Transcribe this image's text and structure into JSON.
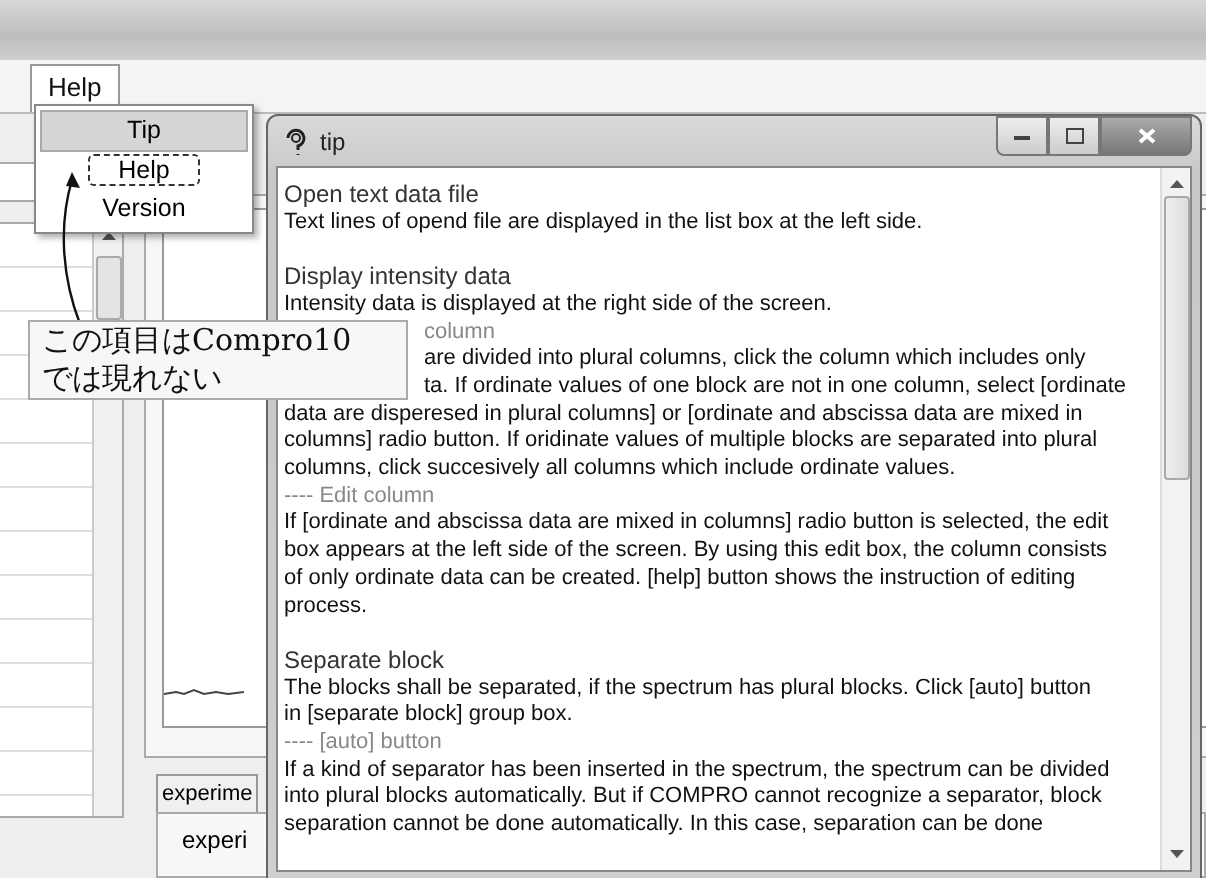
{
  "menu_bar": [
    {
      "label": "Help",
      "selected": true
    }
  ],
  "help_menu": [
    {
      "label": "Tip",
      "selected": true,
      "focused": false
    },
    {
      "label": "Help",
      "selected": false,
      "focused": true
    },
    {
      "label": "Version",
      "selected": false,
      "focused": false
    }
  ],
  "background_window": {
    "tab": "experime",
    "group_label": "experi"
  },
  "tip_window": {
    "title": "tip",
    "sections": [
      {
        "items": [
          {
            "kind": "heading",
            "text": "Open text data file"
          },
          {
            "kind": "text",
            "text": "Text lines of opend file are displayed in the list box at the left side."
          }
        ]
      },
      {
        "items": [
          {
            "kind": "heading",
            "text": "Display intensity data"
          },
          {
            "kind": "text",
            "text": "Intensity data is displayed at the right side of the screen."
          },
          {
            "kind": "sub-clipped",
            "text": "column"
          },
          {
            "kind": "clipped",
            "text": "are divided into plural columns, click the column which includes only"
          },
          {
            "kind": "clipped",
            "text": "ta.  If ordinate values of one block are not in one column, select [ordinate"
          },
          {
            "kind": "text",
            "text": "data are disperesed in plural columns] or [ordinate and abscissa data are mixed in"
          },
          {
            "kind": "text",
            "text": "columns] radio button.  If oridinate values of multiple blocks are separated into plural"
          },
          {
            "kind": "text",
            "text": "columns, click succesively all columns which include ordinate values."
          },
          {
            "kind": "sub",
            "text": "---- Edit column"
          },
          {
            "kind": "text",
            "text": "If [ordinate and abscissa data are mixed in columns] radio button is selected, the edit"
          },
          {
            "kind": "text",
            "text": "box appears at the left side of the screen.  By using this edit box, the column consists"
          },
          {
            "kind": "text",
            "text": "of only ordinate data can be created.  [help] button shows the instruction of editing"
          },
          {
            "kind": "text",
            "text": "process."
          }
        ]
      },
      {
        "items": [
          {
            "kind": "heading",
            "text": "Separate block"
          },
          {
            "kind": "text",
            "text": "The blocks shall be separated, if the spectrum has plural blocks.  Click [auto] button"
          },
          {
            "kind": "text",
            "text": "in [separate block] group box."
          },
          {
            "kind": "sub",
            "text": "---- [auto] button"
          },
          {
            "kind": "text",
            "text": "If a kind of separator has been inserted in the spectrum, the spectrum can be divided"
          },
          {
            "kind": "text",
            "text": "into plural blocks automatically.  But if COMPRO cannot recognize a separator, block"
          },
          {
            "kind": "text",
            "text": "separation cannot be done automatically.  In this case, separation can be done"
          }
        ]
      }
    ]
  },
  "callout": {
    "lines": [
      "この項目はCompro10",
      "では現れない"
    ]
  }
}
